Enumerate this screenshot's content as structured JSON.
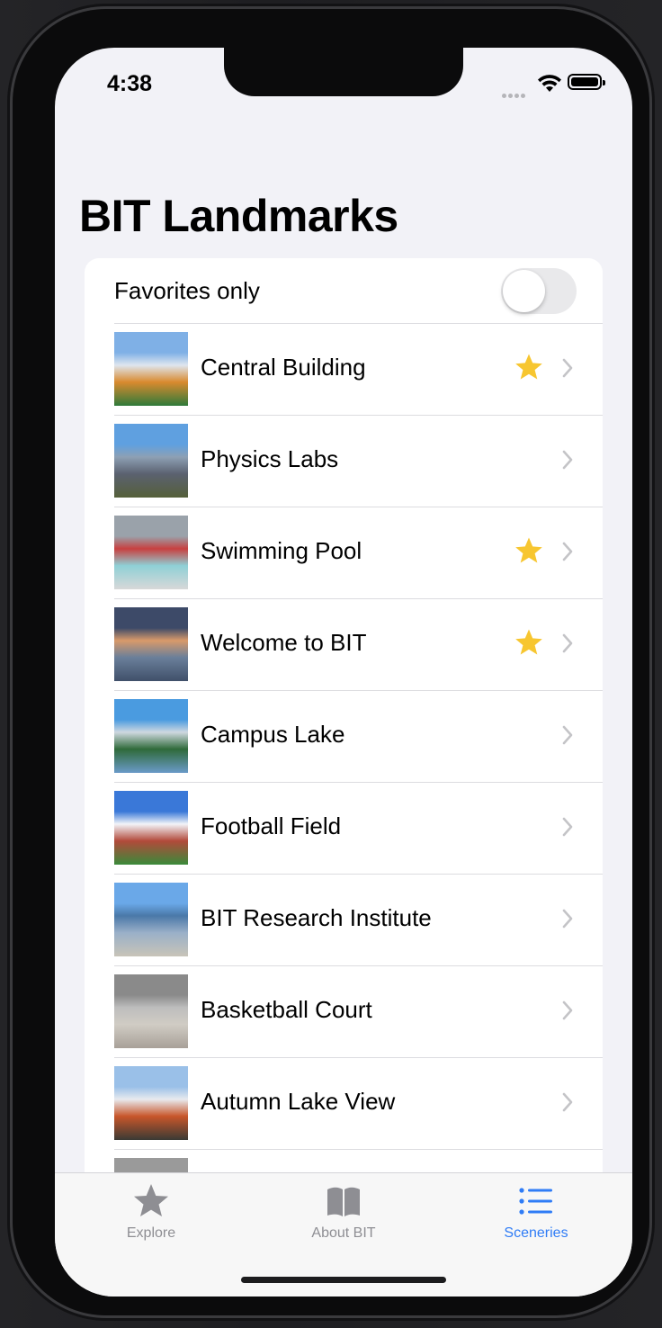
{
  "status_bar": {
    "time": "4:38"
  },
  "nav": {
    "title": "BIT Landmarks"
  },
  "filter": {
    "label": "Favorites only",
    "enabled": false
  },
  "landmarks": [
    {
      "name": "Central Building",
      "favorite": true,
      "thumb": [
        "#7fb0e6",
        "#dfe6ee",
        "#d98a2e",
        "#2f7a3a"
      ]
    },
    {
      "name": "Physics Labs",
      "favorite": false,
      "thumb": [
        "#5fa0e0",
        "#8da0b4",
        "#5b6170",
        "#55603a"
      ]
    },
    {
      "name": "Swimming Pool",
      "favorite": true,
      "thumb": [
        "#9aa2aa",
        "#c84040",
        "#8fd0d6",
        "#d8d8d8"
      ]
    },
    {
      "name": "Welcome to BIT",
      "favorite": true,
      "thumb": [
        "#3d4a68",
        "#d99a6a",
        "#6a7f9a",
        "#40506a"
      ]
    },
    {
      "name": "Campus Lake",
      "favorite": false,
      "thumb": [
        "#4a9be0",
        "#cfd8e0",
        "#2f6a3a",
        "#6a9ac8"
      ]
    },
    {
      "name": "Football Field",
      "favorite": false,
      "thumb": [
        "#3a78d8",
        "#f2f4f8",
        "#b24a3a",
        "#3a8a3a"
      ]
    },
    {
      "name": "BIT Research Institute",
      "favorite": false,
      "thumb": [
        "#6aa8e8",
        "#4a78a8",
        "#9ab0c8",
        "#c8c4b8"
      ]
    },
    {
      "name": "Basketball Court",
      "favorite": false,
      "thumb": [
        "#8a8a8a",
        "#bdbdbd",
        "#d0ccc4",
        "#a8a098"
      ]
    },
    {
      "name": "Autumn Lake View",
      "favorite": false,
      "thumb": [
        "#9ac0e8",
        "#e8eaee",
        "#c8562a",
        "#3a3a34"
      ]
    },
    {
      "name": "",
      "favorite": false,
      "thumb": [
        "#9a9a9a",
        "#e8e8e8",
        "#bdbdbd",
        "#d8d8d8"
      ]
    }
  ],
  "tabs": [
    {
      "label": "Explore",
      "icon": "star-icon",
      "active": false
    },
    {
      "label": "About BIT",
      "icon": "book-icon",
      "active": false
    },
    {
      "label": "Sceneries",
      "icon": "list-icon",
      "active": true
    }
  ],
  "colors": {
    "accent": "#2f7cf6",
    "star": "#f7c630",
    "inactive": "#8e8e93",
    "chevron": "#c4c4c7"
  }
}
